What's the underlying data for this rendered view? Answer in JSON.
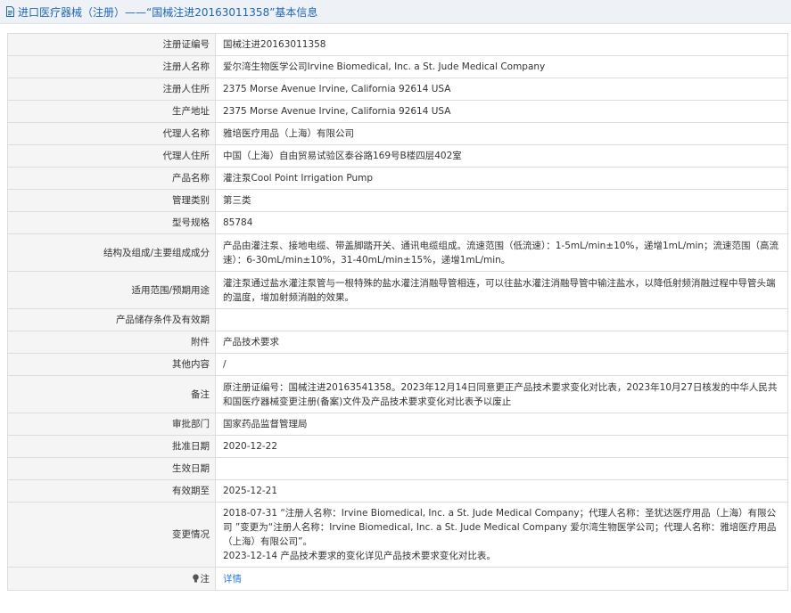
{
  "header": {
    "title": "进口医疗器械（注册）——“国械注进20163011358”基本信息"
  },
  "rows": [
    {
      "label": "注册证编号",
      "value": "国械注进20163011358"
    },
    {
      "label": "注册人名称",
      "value": "爱尔湾生物医学公司Irvine Biomedical, Inc. a St. Jude Medical Company"
    },
    {
      "label": "注册人住所",
      "value": "2375 Morse Avenue Irvine, California 92614 USA"
    },
    {
      "label": "生产地址",
      "value": "2375 Morse Avenue Irvine, California 92614 USA"
    },
    {
      "label": "代理人名称",
      "value": "雅培医疗用品（上海）有限公司"
    },
    {
      "label": "代理人住所",
      "value": "中国（上海）自由贸易试验区泰谷路169号B楼四层402室"
    },
    {
      "label": "产品名称",
      "value": "灌注泵Cool Point Irrigation Pump"
    },
    {
      "label": "管理类别",
      "value": "第三类"
    },
    {
      "label": "型号规格",
      "value": "85784"
    },
    {
      "label": "结构及组成/主要组成成分",
      "value": "产品由灌注泵、接地电缆、带盖脚踏开关、通讯电缆组成。流速范围（低流速）：1-5mL/min±10%，递增1mL/min；流速范围（高流速）：6-30mL/min±10%，31-40mL/min±15%，递增1mL/min。"
    },
    {
      "label": "适用范围/预期用途",
      "value": "灌注泵通过盐水灌注泵管与一根特殊的盐水灌注消融导管相连，可以往盐水灌注消融导管中输注盐水，以降低射频消融过程中导管头端的温度，增加射频消融的效果。"
    },
    {
      "label": "产品储存条件及有效期",
      "value": ""
    },
    {
      "label": "附件",
      "value": "产品技术要求"
    },
    {
      "label": "其他内容",
      "value": "/"
    },
    {
      "label": "备注",
      "value": "原注册证编号：国械注进20163541358。2023年12月14日同意更正产品技术要求变化对比表，2023年10月27日核发的中华人民共和国医疗器械变更注册(备案)文件及产品技术要求变化对比表予以废止"
    },
    {
      "label": "审批部门",
      "value": "国家药品监督管理局"
    },
    {
      "label": "批准日期",
      "value": "2020-12-22"
    },
    {
      "label": "生效日期",
      "value": ""
    },
    {
      "label": "有效期至",
      "value": "2025-12-21"
    }
  ],
  "change": {
    "label": "变更情况",
    "line1": "2018-07-31 “注册人名称：Irvine Biomedical, Inc. a St. Jude Medical Company；代理人名称：圣犹达医疗用品（上海）有限公司 ”变更为“注册人名称：Irvine Biomedical, Inc. a St. Jude Medical Company 爱尔湾生物医学公司；代理人名称：雅培医疗用品（上海）有限公司”。",
    "line2": "2023-12-14 产品技术要求的变化详见产品技术要求变化对比表。"
  },
  "note": {
    "label": "注",
    "icon": "bulb-icon",
    "link_text": "详情"
  }
}
